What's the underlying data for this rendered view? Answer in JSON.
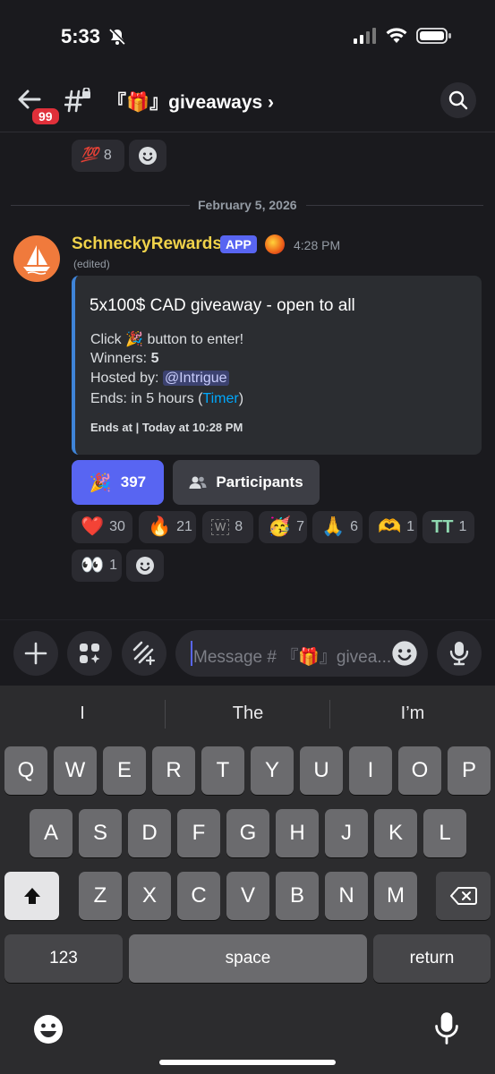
{
  "status_bar": {
    "time": "5:33"
  },
  "header": {
    "unread_count": "99",
    "channel_name": "『🎁』giveaways ›"
  },
  "prev_reactions": [
    {
      "emoji": "💯",
      "count": "8"
    }
  ],
  "date_divider": "February 5, 2026",
  "message": {
    "username": "SchneckyRewards",
    "app_tag": "APP",
    "timestamp": "4:28 PM",
    "edited": "(edited)",
    "embed": {
      "title": "5x100$ CAD giveaway - open to all",
      "click_pre": "Click ",
      "click_emoji": "🎉",
      "click_post": " button to enter!",
      "winners_label": "Winners: ",
      "winners_value": "5",
      "hosted_label": "Hosted by: ",
      "host_mention": "@Intrigue",
      "ends_label": "Ends: in 5 hours (",
      "timer_link": "Timer",
      "ends_close": ")",
      "footer": "Ends at | Today at 10:28 PM"
    },
    "enter_button": {
      "emoji": "🎉",
      "count": "397"
    },
    "participants_button": "Participants",
    "reactions": [
      {
        "emoji": "❤️",
        "count": "30"
      },
      {
        "emoji": "🔥",
        "count": "21"
      },
      {
        "emoji": "W",
        "count": "8"
      },
      {
        "emoji": "🥳",
        "count": "7"
      },
      {
        "emoji": "🙏",
        "count": "6"
      },
      {
        "emoji": "🫶",
        "count": "1"
      },
      {
        "emoji": "TT",
        "count": "1"
      },
      {
        "emoji": "👀",
        "count": "1"
      }
    ]
  },
  "composer": {
    "placeholder": "Message # 『🎁』giveа..."
  },
  "keyboard": {
    "suggestions": [
      "I",
      "The",
      "I’m"
    ],
    "row1": [
      "Q",
      "W",
      "E",
      "R",
      "T",
      "Y",
      "U",
      "I",
      "O",
      "P"
    ],
    "row2": [
      "A",
      "S",
      "D",
      "F",
      "G",
      "H",
      "J",
      "K",
      "L"
    ],
    "row3": [
      "Z",
      "X",
      "C",
      "V",
      "B",
      "N",
      "M"
    ],
    "numbers_key": "123",
    "space_key": "space",
    "return_key": "return"
  }
}
